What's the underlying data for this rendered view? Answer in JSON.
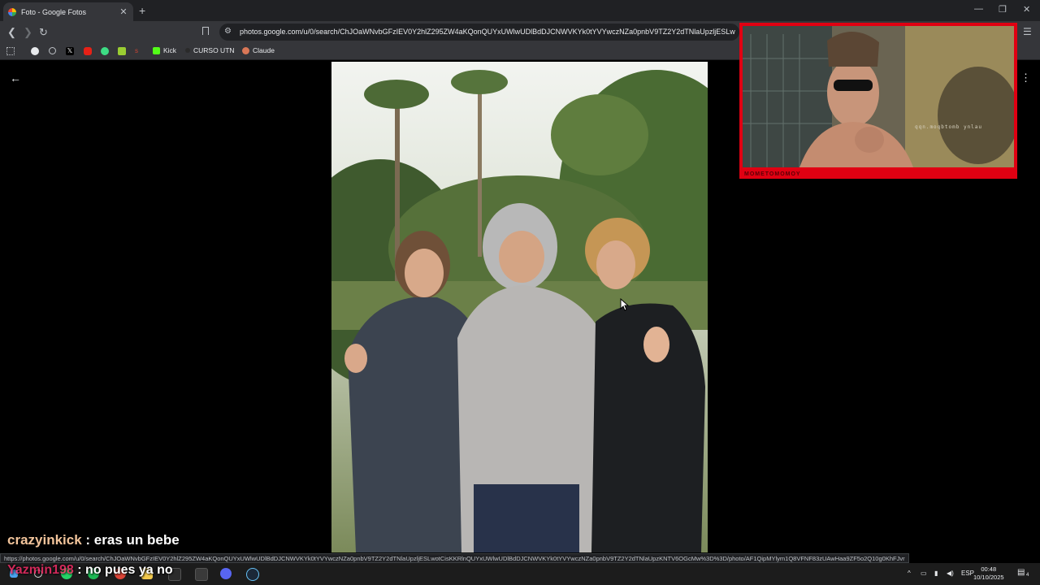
{
  "browser": {
    "tab_title": "Foto - Google Fotos",
    "tab_close": "✕",
    "new_tab": "+",
    "url": "photos.google.com/u/0/search/ChJOaWNvbGFzIEV0Y2hlZ295ZW4aKQonQUYxUWlwUDlBdDJCNWVKYk0tYVYwczNZa0pnbV9TZ2Y2dTNlaUpzljESLwo...",
    "bookmarks": [
      {
        "label": "Kick"
      },
      {
        "label": "CURSO UTN"
      },
      {
        "label": "Claude"
      }
    ],
    "window_controls": [
      "—",
      "❐",
      "✕"
    ],
    "status_url": "https://photos.google.com/u/0/search/ChJOaWNvbGFzIEV0Y2hlZ295ZW4aKQonQUYxUWlwUDlBdDJCNWVKYk0tYVYwczNZa0pnbV9TZ2Y2dTNlaUpzljESLwotCisKKRlnQUYxUWlwUDlBdDJCNWVKYk0tYVYwczNZa0pnbV9TZ2Y2dTNlaUpzKNTV6OGcMw%3D%3D/photo/AF1QipMYlym1Q8VFNF83zUAwHaa9ZF5o2Q10g0KhFJvr"
  },
  "viewer": {
    "back_icon": "arrow-left-icon",
    "more_icon": "more-vertical-icon"
  },
  "webcam": {
    "name_plate": "MOMETOMOMOY",
    "watermark": "qqn.moqbtomb ynlau"
  },
  "chat": [
    {
      "user": "crazyinkick",
      "sep": " : ",
      "message": "eras un bebe"
    },
    {
      "user": "Yazmin198",
      "sep": " : ",
      "message": "no pues ya no"
    }
  ],
  "taskbar": {
    "language": "ESP",
    "time": "00:48",
    "date": "10/10/2025",
    "notification_count": "4"
  },
  "colors": {
    "cam_border": "#e00012",
    "chat_user1": "#f2c49b",
    "chat_user2": "#ff2d6a"
  }
}
